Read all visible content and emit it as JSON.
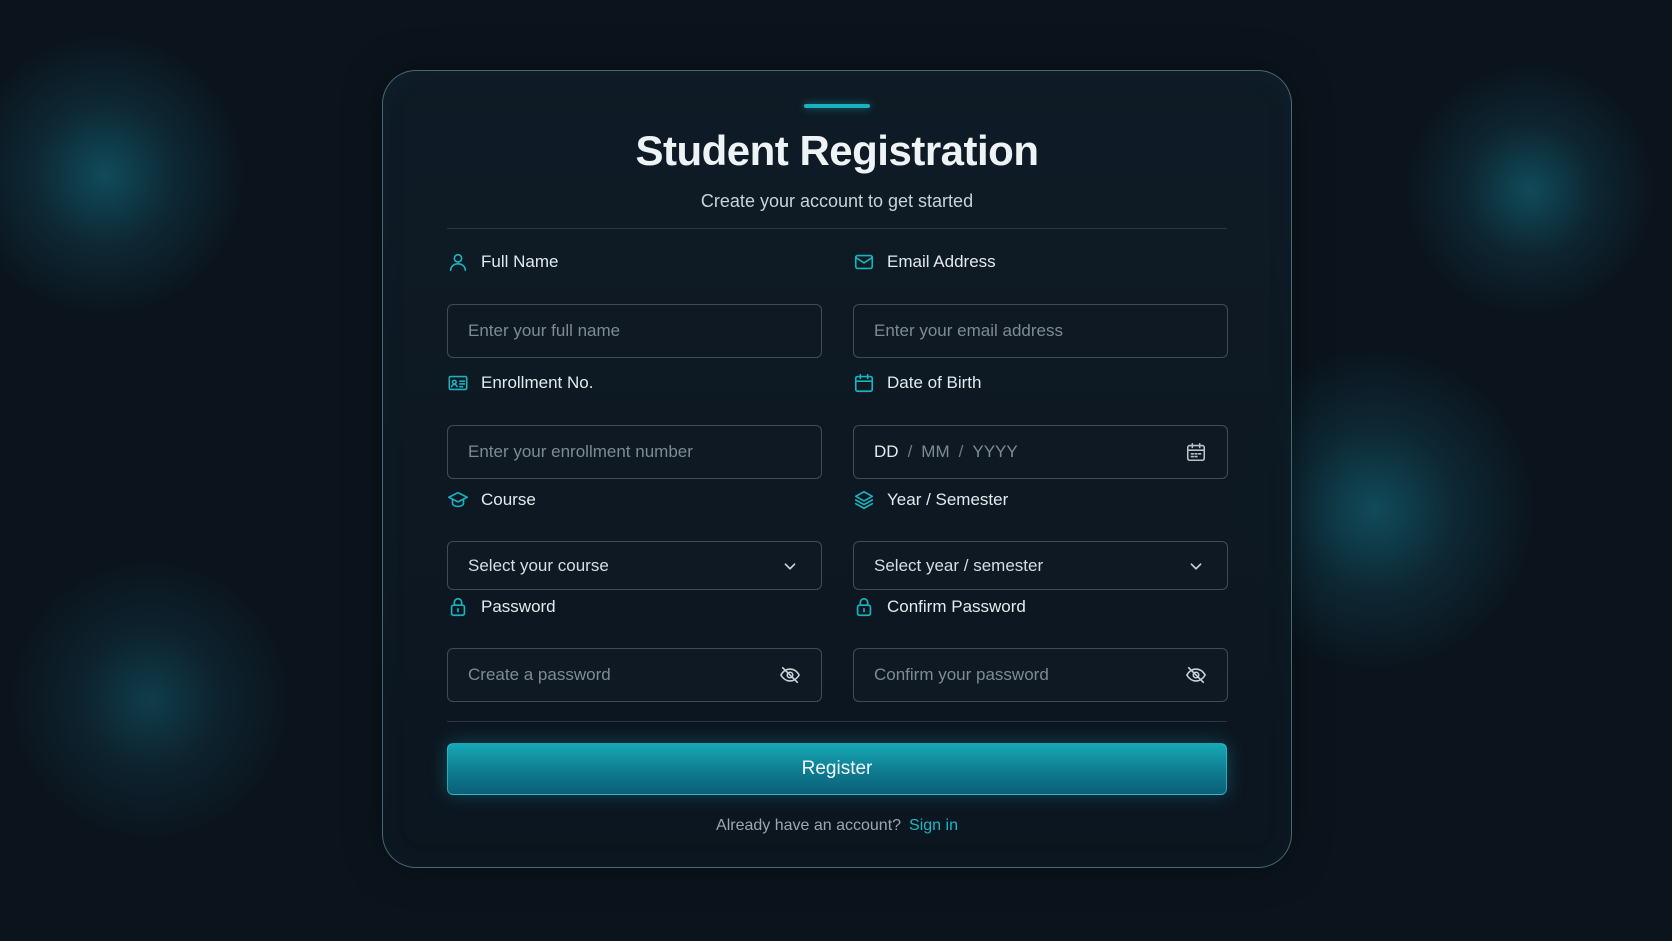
{
  "header": {
    "title": "Student Registration",
    "subtitle": "Create your account to get started"
  },
  "form": {
    "full_name": {
      "label": "Full Name",
      "placeholder": "Enter your full name",
      "icon": "user-icon"
    },
    "email": {
      "label": "Email Address",
      "placeholder": "Enter your email address",
      "icon": "mail-icon"
    },
    "enrollment": {
      "label": "Enrollment No.",
      "placeholder": "Enter your enrollment number",
      "icon": "id-card-icon"
    },
    "dob": {
      "label": "Date of Birth",
      "day": "DD",
      "month": "MM",
      "year": "YYYY",
      "separator": "/",
      "icon": "calendar-icon"
    },
    "course": {
      "label": "Course",
      "selected": "Select your course",
      "icon": "graduation-cap-icon"
    },
    "year_semester": {
      "label": "Year / Semester",
      "selected": "Select year / semester",
      "icon": "layers-icon"
    },
    "password": {
      "label": "Password",
      "placeholder": "Create a password",
      "icon": "lock-icon"
    },
    "confirm_password": {
      "label": "Confirm Password",
      "placeholder": "Confirm your password",
      "icon": "lock-icon"
    }
  },
  "actions": {
    "register_label": "Register",
    "signin_prompt": "Already have an account?",
    "signin_link": "Sign in"
  },
  "colors": {
    "background": "#0b141d",
    "accent": "#19b3bf",
    "card_border": "#78aab4",
    "link": "#1cb8c6"
  }
}
